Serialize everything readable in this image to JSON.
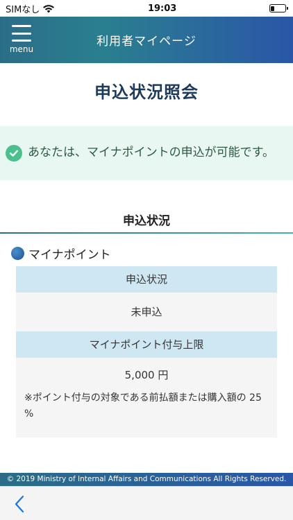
{
  "status_bar": {
    "carrier": "SIMなし",
    "time": "19:03"
  },
  "header": {
    "menu_label": "menu",
    "title": "利用者マイページ"
  },
  "page": {
    "title": "申込状況照会"
  },
  "notice": {
    "text": "あなたは、マイナポイントの申込が可能です。"
  },
  "section": {
    "title": "申込状況",
    "item_label": "マイナポイント",
    "rows": [
      {
        "header": "申込状況",
        "value": "未申込"
      },
      {
        "header": "マイナポイント付与上限",
        "value": "5,000 円",
        "note": "※ポイント付与の対象である前払額または購入額の 25 %"
      }
    ]
  },
  "footer": {
    "copyright": "© 2019 Ministry of Internal Affairs and Communications All Rights Reserved."
  },
  "colors": {
    "accent_start": "#2b6d87",
    "accent_end": "#2a56a8",
    "success": "#4cbf8f",
    "table_header": "#cfe6f3"
  }
}
